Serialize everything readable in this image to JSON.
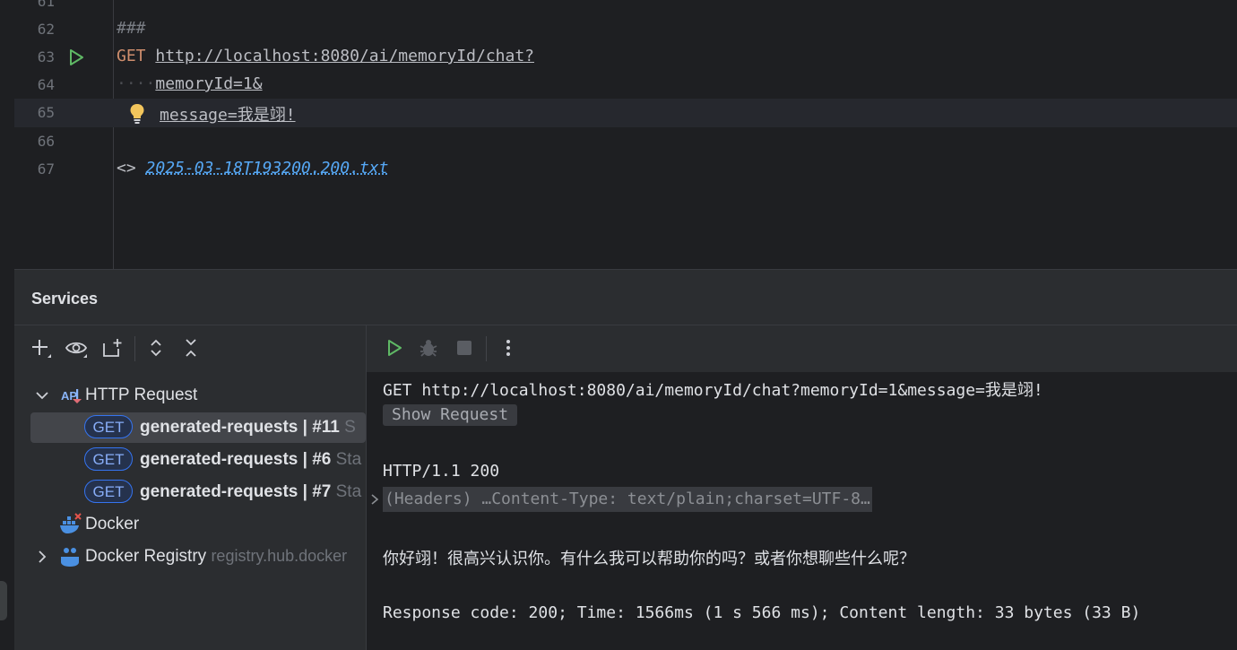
{
  "editor": {
    "lines": [
      {
        "num": "61",
        "text": ""
      },
      {
        "num": "62",
        "text": "###"
      },
      {
        "num": "63",
        "method": "GET",
        "url": "http://localhost:8080/ai/memoryId/chat?"
      },
      {
        "num": "64",
        "dots": "····",
        "text": "memoryId=1&"
      },
      {
        "num": "65",
        "text": "message=我是翊!"
      },
      {
        "num": "66",
        "text": ""
      },
      {
        "num": "67",
        "prefix": "<>",
        "file": "2025-03-18T193200.200.txt"
      }
    ]
  },
  "services": {
    "title": "Services",
    "toolbar_icons": [
      "add-icon",
      "eye-icon",
      "new-tab-icon",
      "expand-all-icon",
      "collapse-all-icon"
    ],
    "tree": {
      "http_group": {
        "icon": "api-icon",
        "label": "HTTP Request"
      },
      "requests": [
        {
          "method": "GET",
          "name": "generated-requests  |  #11",
          "tail": " S",
          "selected": true
        },
        {
          "method": "GET",
          "name": "generated-requests  |  #6",
          "tail": " Sta"
        },
        {
          "method": "GET",
          "name": "generated-requests  |  #7",
          "tail": " Sta"
        }
      ],
      "docker": {
        "icon": "docker-icon",
        "label": "Docker"
      },
      "docker_registry": {
        "icon": "docker-registry-icon",
        "label": "Docker Registry",
        "detail": "registry.hub.docker"
      }
    },
    "response": {
      "toolbar_icons": [
        "run-icon",
        "debug-icon",
        "stop-icon",
        "more-icon"
      ],
      "request_line": "GET http://localhost:8080/ai/memoryId/chat?memoryId=1&message=我是翊!",
      "show_request": "Show Request",
      "status_line": "HTTP/1.1 200 ",
      "headers": "(Headers) …Content-Type: text/plain;charset=UTF-8…",
      "body": "你好翊！很高兴认识你。有什么我可以帮助你的吗？或者你想聊些什么呢？",
      "footer": "Response code: 200; Time: 1566ms (1 s 566 ms); Content length: 33 bytes (33 B)"
    }
  },
  "colors": {
    "accent": "#3574f0",
    "run_green": "#5fb865",
    "bulb_yellow": "#f2c55c"
  }
}
